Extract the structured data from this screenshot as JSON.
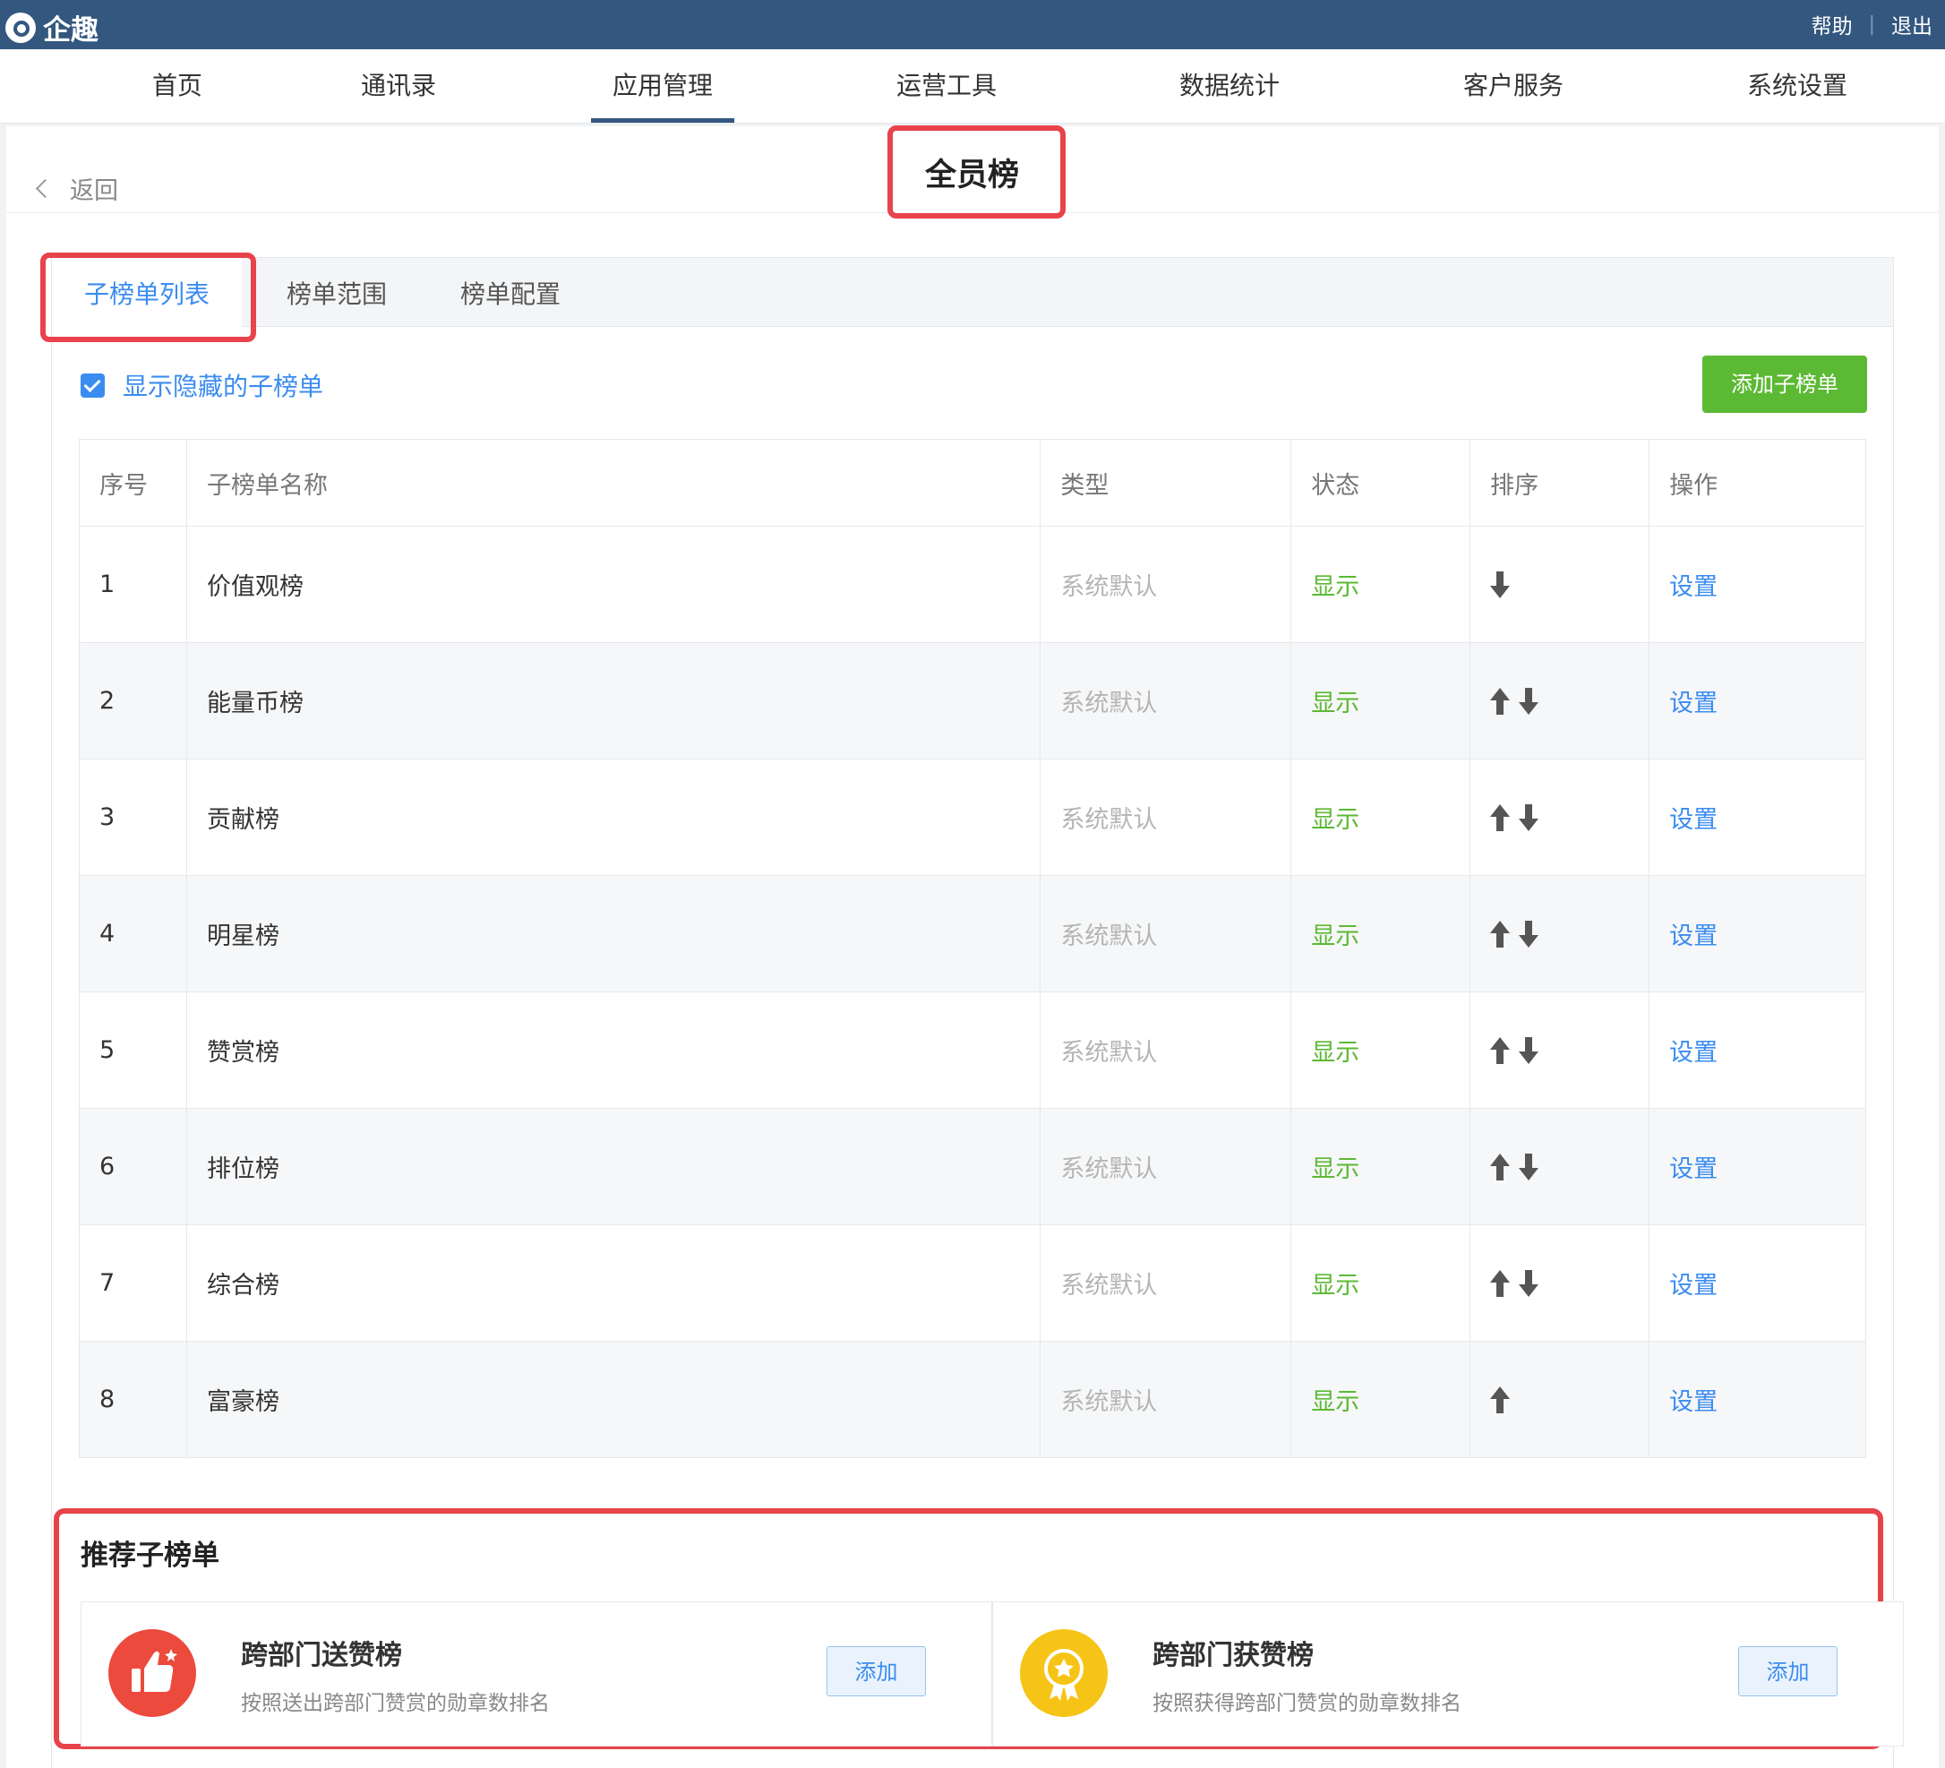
{
  "app": {
    "name": "企趣",
    "help": "帮助",
    "logout": "退出"
  },
  "nav": [
    "首页",
    "通讯录",
    "应用管理",
    "运营工具",
    "数据统计",
    "客户服务",
    "系统设置"
  ],
  "page": {
    "back": "返回",
    "title": "全员榜"
  },
  "tabs": [
    "子榜单列表",
    "榜单范围",
    "榜单配置"
  ],
  "show_hidden": {
    "label": "显示隐藏的子榜单",
    "checked": true
  },
  "add_button": "添加子榜单",
  "table": {
    "headers": [
      "序号",
      "子榜单名称",
      "类型",
      "状态",
      "排序",
      "操作"
    ],
    "rows": [
      {
        "no": "1",
        "name": "价值观榜",
        "type": "系统默认",
        "status": "显示",
        "sort": [
          "down"
        ],
        "action": "设置"
      },
      {
        "no": "2",
        "name": "能量币榜",
        "type": "系统默认",
        "status": "显示",
        "sort": [
          "up",
          "down"
        ],
        "action": "设置"
      },
      {
        "no": "3",
        "name": "贡献榜",
        "type": "系统默认",
        "status": "显示",
        "sort": [
          "up",
          "down"
        ],
        "action": "设置"
      },
      {
        "no": "4",
        "name": "明星榜",
        "type": "系统默认",
        "status": "显示",
        "sort": [
          "up",
          "down"
        ],
        "action": "设置"
      },
      {
        "no": "5",
        "name": "赞赏榜",
        "type": "系统默认",
        "status": "显示",
        "sort": [
          "up",
          "down"
        ],
        "action": "设置"
      },
      {
        "no": "6",
        "name": "排位榜",
        "type": "系统默认",
        "status": "显示",
        "sort": [
          "up",
          "down"
        ],
        "action": "设置"
      },
      {
        "no": "7",
        "name": "综合榜",
        "type": "系统默认",
        "status": "显示",
        "sort": [
          "up",
          "down"
        ],
        "action": "设置"
      },
      {
        "no": "8",
        "name": "富豪榜",
        "type": "系统默认",
        "status": "显示",
        "sort": [
          "up"
        ],
        "action": "设置"
      }
    ]
  },
  "recommend": {
    "title": "推荐子榜单",
    "items": [
      {
        "name": "跨部门送赞榜",
        "desc": "按照送出跨部门赞赏的勋章数排名",
        "add": "添加",
        "icon": "thumbs-up-icon",
        "color": "#ec4a3d"
      },
      {
        "name": "跨部门获赞榜",
        "desc": "按照获得跨部门赞赏的勋章数排名",
        "add": "添加",
        "icon": "medal-icon",
        "color": "#f6c416"
      }
    ]
  },
  "colors": {
    "topbar": "#33577f",
    "accent": "#3b8cf0",
    "green": "#5cb934",
    "highlight": "#e8434b"
  }
}
